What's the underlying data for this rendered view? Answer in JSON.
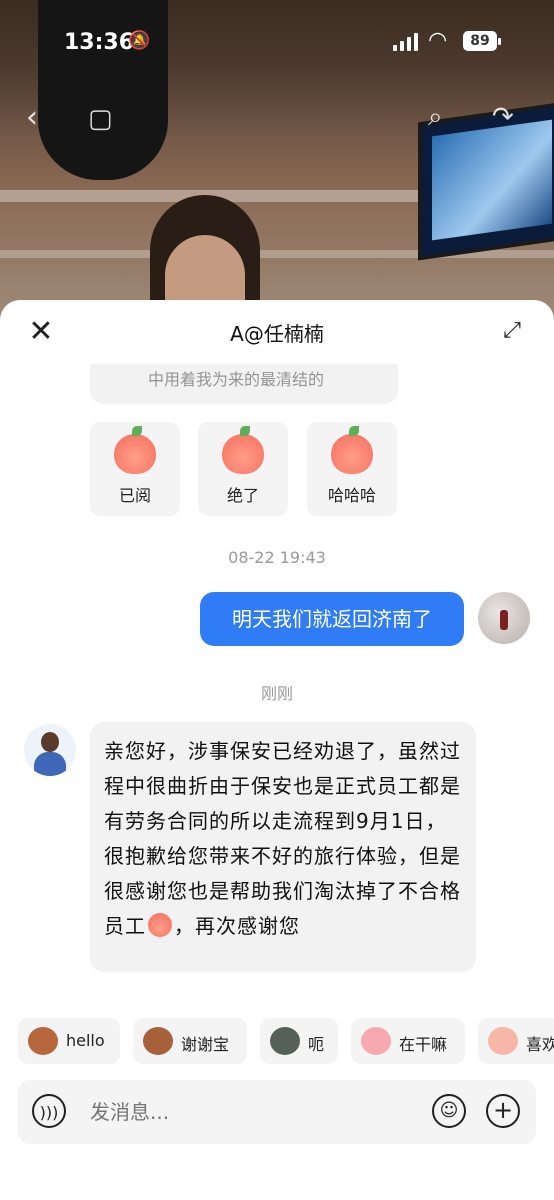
{
  "status_bar": {
    "time": "13:36",
    "battery": "89"
  },
  "header": {
    "title": "A@任楠楠"
  },
  "prev_message": {
    "text": "中用着我为来的最清结的"
  },
  "sticker_row": [
    {
      "label": "已阅",
      "color": "#f46d5b"
    },
    {
      "label": "绝了",
      "color": "#f46d5b"
    },
    {
      "label": "哈哈哈",
      "color": "#f46d5b"
    }
  ],
  "messages": {
    "time1": "08-22 19:43",
    "outgoing": "明天我们就返回济南了",
    "time2": "刚刚",
    "incoming_part1": "亲您好，涉事保安已经劝退了，虽然过程中很曲折由于保安也是正式员工都是有劳务合同的所以走流程到9月1日，很抱歉给您带来不好的旅行体验，但是很感谢您也是帮助我们淘汰掉了不合格员工",
    "incoming_part2": "，再次感谢您"
  },
  "quick_replies": [
    {
      "label": "hello",
      "icon": "monkey-icon"
    },
    {
      "label": "谢谢宝",
      "icon": "monkey-icon"
    },
    {
      "label": "呃",
      "icon": "cat-icon"
    },
    {
      "label": "在干嘛",
      "icon": "peach-icon"
    },
    {
      "label": "喜欢",
      "icon": "peach-icon"
    }
  ],
  "input": {
    "placeholder": "发消息..."
  },
  "colors": {
    "accent": "#2f7cf6",
    "bubble_gray": "#f2f2f2"
  }
}
